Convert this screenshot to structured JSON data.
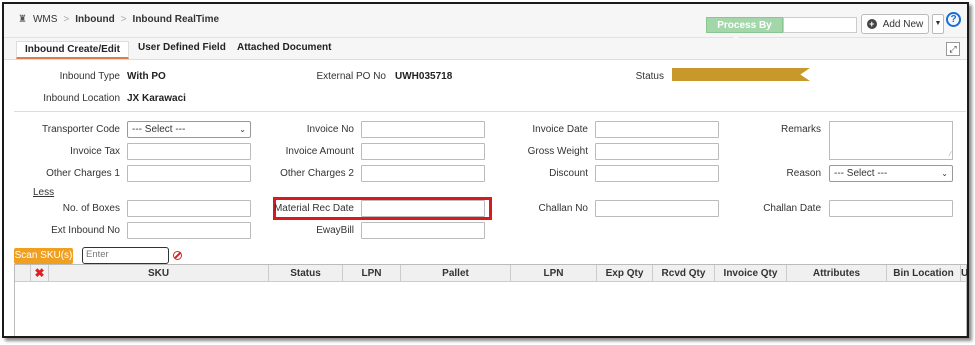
{
  "breadcrumb": {
    "home": "WMS",
    "parent": "Inbound",
    "current": "Inbound RealTime"
  },
  "toolbar": {
    "process_by_scan": "Process By Scan",
    "add_new": "Add New",
    "help": "?"
  },
  "tabs": [
    "Inbound Create/Edit",
    "User Defined Field",
    "Attached Document"
  ],
  "header": {
    "inbound_type_label": "Inbound Type",
    "inbound_type_value": "With PO",
    "external_po_label": "External PO No",
    "external_po_value": "UWH035718",
    "status_label": "Status",
    "status_color": "#c9982a",
    "inbound_location_label": "Inbound Location",
    "inbound_location_value": "JX Karawaci"
  },
  "form": {
    "transporter_code": "Transporter Code",
    "transporter_select": "--- Select ---",
    "invoice_no": "Invoice No",
    "invoice_date": "Invoice Date",
    "remarks": "Remarks",
    "invoice_tax": "Invoice Tax",
    "invoice_amount": "Invoice Amount",
    "gross_weight": "Gross Weight",
    "other_charges_1": "Other Charges 1",
    "other_charges_2": "Other Charges 2",
    "discount": "Discount",
    "reason": "Reason",
    "reason_select": "--- Select ---",
    "less": "Less",
    "no_of_boxes": "No. of Boxes",
    "material_rec_date": "Material Rec Date",
    "challan_no": "Challan No",
    "challan_date": "Challan Date",
    "ext_inbound_no": "Ext Inbound No",
    "ewaybill": "EwayBill"
  },
  "scan": {
    "button": "Scan SKU(s)",
    "placeholder": "Enter SKU/Barcode"
  },
  "grid": {
    "columns": [
      "SKU",
      "Status",
      "LPN",
      "Pallet",
      "LPN",
      "Exp Qty",
      "Rcvd Qty",
      "Invoice Qty",
      "Attributes",
      "Bin Location",
      "U"
    ]
  },
  "colors": {
    "highlight": "#d71920",
    "scan_button": "#f0a020",
    "process_scan": "#a3d7a9",
    "tab_underline": "#e07b4a"
  }
}
